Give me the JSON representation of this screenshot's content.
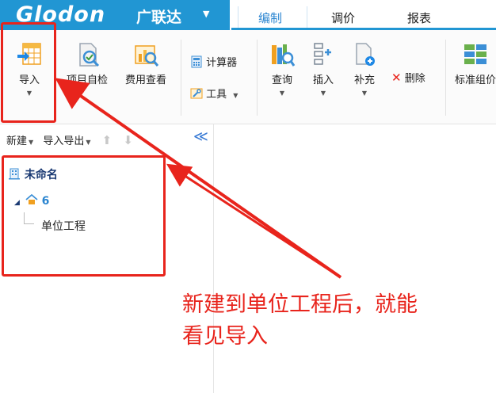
{
  "app": {
    "brand_logo": "Glodon",
    "brand_cn": "广联达",
    "brand_dropdown": "▼"
  },
  "tabs": [
    {
      "label": "编制",
      "active": true
    },
    {
      "label": "调价",
      "active": false
    },
    {
      "label": "报表",
      "active": false
    }
  ],
  "ribbon": {
    "import": {
      "label": "导入",
      "icon": "table-import-icon"
    },
    "project_check": {
      "label": "项目自检",
      "icon": "document-check-icon"
    },
    "fee_view": {
      "label": "费用查看",
      "icon": "coins-chart-icon"
    },
    "calculator": {
      "label": "计算器",
      "icon": "calculator-icon"
    },
    "tools": {
      "label": "工具",
      "icon": "tools-icon"
    },
    "query": {
      "label": "查询",
      "icon": "books-search-icon"
    },
    "insert": {
      "label": "插入",
      "icon": "insert-rows-icon"
    },
    "supplement": {
      "label": "补充",
      "icon": "document-add-icon"
    },
    "delete": {
      "label": "删除",
      "icon": "x-delete-icon"
    },
    "standard_group": {
      "label": "标准组价",
      "icon": "grid-group-icon"
    }
  },
  "panel": {
    "new_label": "新建",
    "import_export_label": "导入导出",
    "collapse_glyph": "≪"
  },
  "tree": {
    "root": "未命名",
    "node": "6",
    "leaf": "单位工程"
  },
  "annotation": {
    "text_line1": "新建到单位工程后，就能",
    "text_line2": "看见导入"
  },
  "colors": {
    "brand_blue": "#2196d3",
    "annotation_red": "#e8241c"
  }
}
